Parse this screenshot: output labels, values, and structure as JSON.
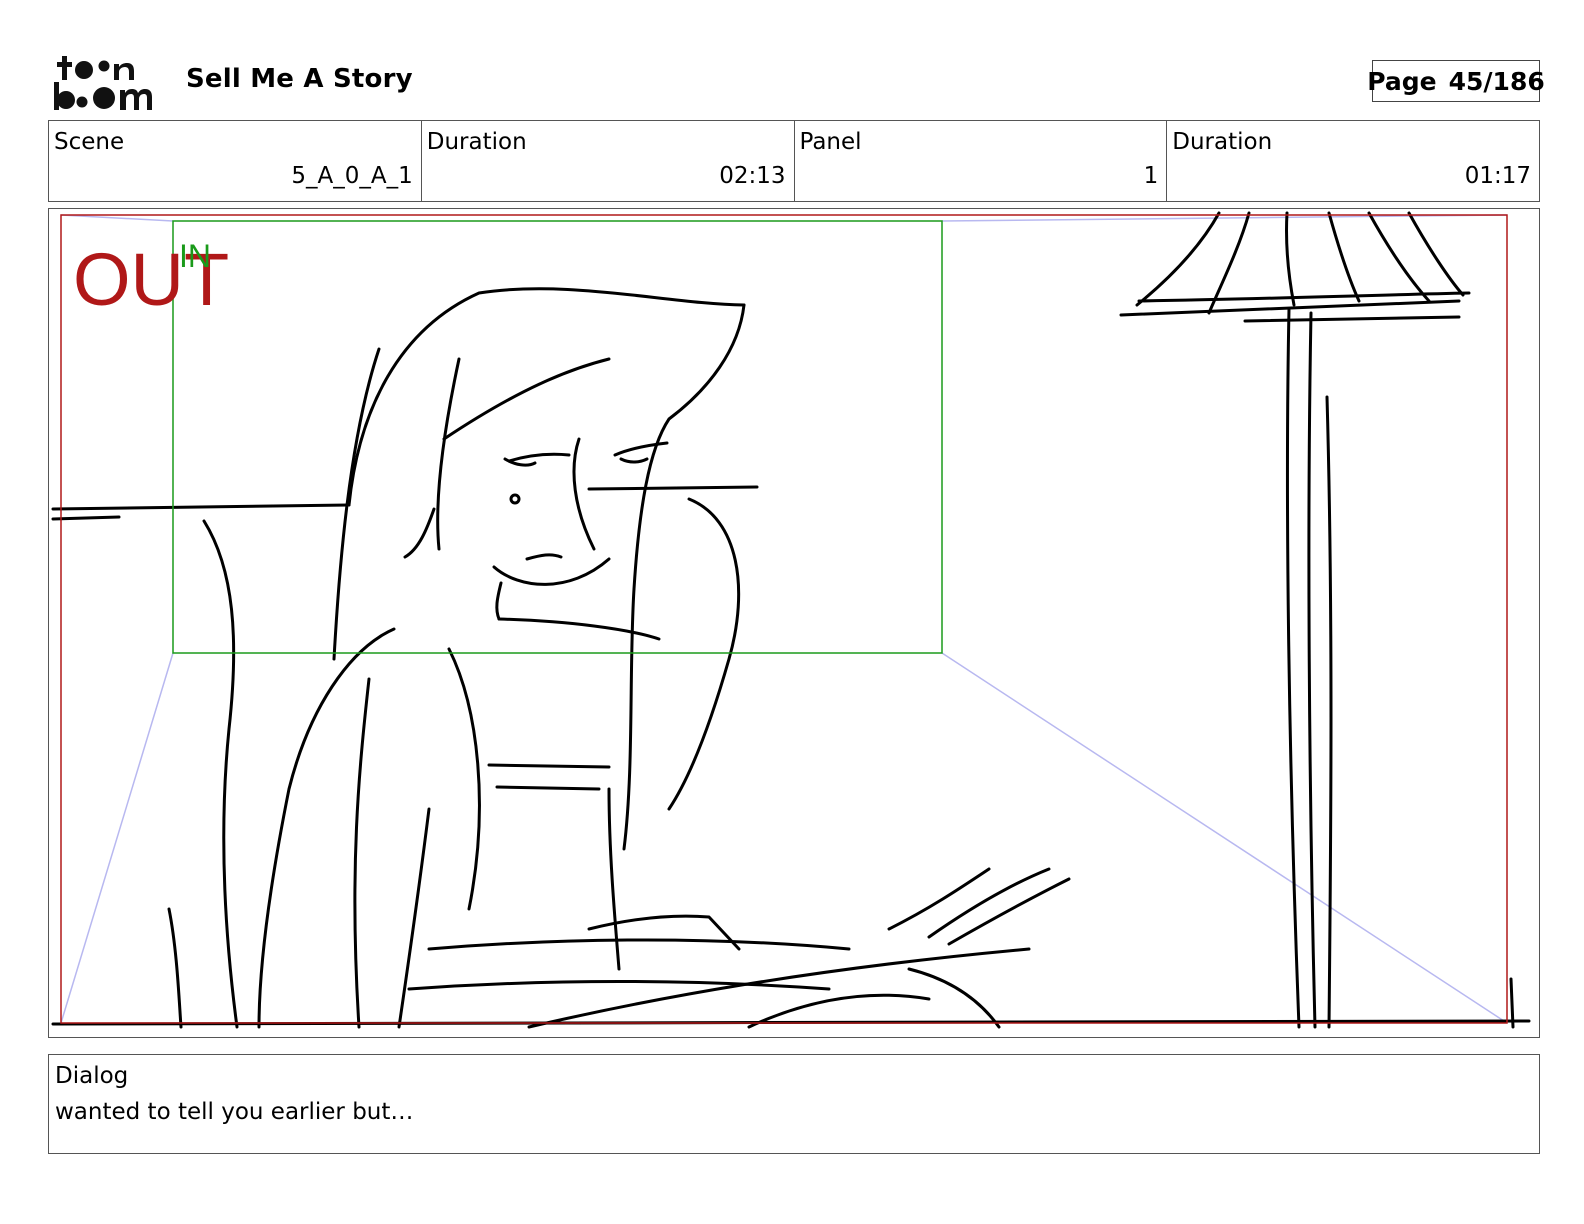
{
  "header": {
    "logo_text": "toonboom",
    "title": "Sell Me A Story",
    "page_label": "Page",
    "page_value": "45/186"
  },
  "info": {
    "scene_label": "Scene",
    "scene_value": "5_A_0_A_1",
    "scene_duration_label": "Duration",
    "scene_duration_value": "02:13",
    "panel_label": "Panel",
    "panel_value": "1",
    "panel_duration_label": "Duration",
    "panel_duration_value": "01:17"
  },
  "panel": {
    "out_label": "OUT",
    "in_label": "IN",
    "out_color": "#b01818",
    "in_color": "#1a9a1a",
    "guide_color": "#b8b8f0"
  },
  "dialog": {
    "label": "Dialog",
    "text": "wanted to tell you earlier but…"
  }
}
